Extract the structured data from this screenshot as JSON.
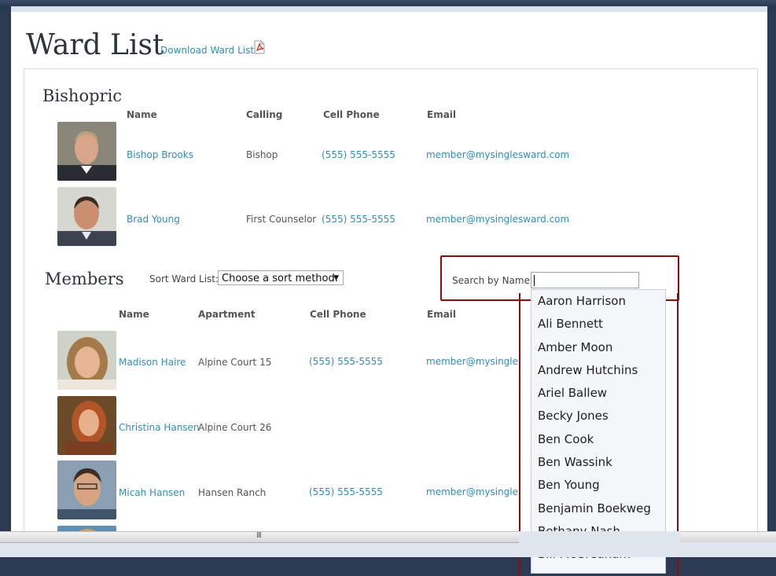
{
  "page": {
    "title": "Ward List",
    "download_label": "Download Ward List"
  },
  "bishopric": {
    "title": "Bishopric",
    "columns": [
      "Name",
      "Calling",
      "Cell Phone",
      "Email"
    ],
    "rows": [
      {
        "name": "Bishop Brooks",
        "calling": "Bishop",
        "phone": "(555) 555-5555",
        "email": "member@mysinglesward.com"
      },
      {
        "name": "Brad Young",
        "calling": "First Counselor",
        "phone": "(555) 555-5555",
        "email": "member@mysinglesward.com"
      }
    ]
  },
  "members": {
    "title": "Members",
    "sort_label": "Sort Ward List:",
    "sort_value": "Choose a sort method:",
    "search_label": "Search by Name:",
    "search_value": "",
    "columns": [
      "Name",
      "Apartment",
      "Cell Phone",
      "Email"
    ],
    "rows": [
      {
        "name": "Madison Haire",
        "apartment": "Alpine Court 15",
        "phone": "(555) 555-5555",
        "email": "member@mysinglesward.com"
      },
      {
        "name": "Christina Hansen",
        "apartment": "Alpine Court 26",
        "phone": "",
        "email": ""
      },
      {
        "name": "Micah Hansen",
        "apartment": "Hansen Ranch",
        "phone": "(555) 555-5555",
        "email": "member@mysinglesward.com"
      }
    ]
  },
  "autocomplete": [
    "Aaron Harrison",
    "Ali Bennett",
    "Amber Moon",
    "Andrew Hutchins",
    "Ariel Ballew",
    "Becky Jones",
    "Ben Cook",
    "Ben Wassink",
    "Ben Young",
    "Benjamin Boekweg",
    "Bethany Nash",
    "Bill McGreaham"
  ],
  "colors": {
    "accent_link": "#2f8fb8",
    "highlight_border": "#8b0d0d"
  }
}
